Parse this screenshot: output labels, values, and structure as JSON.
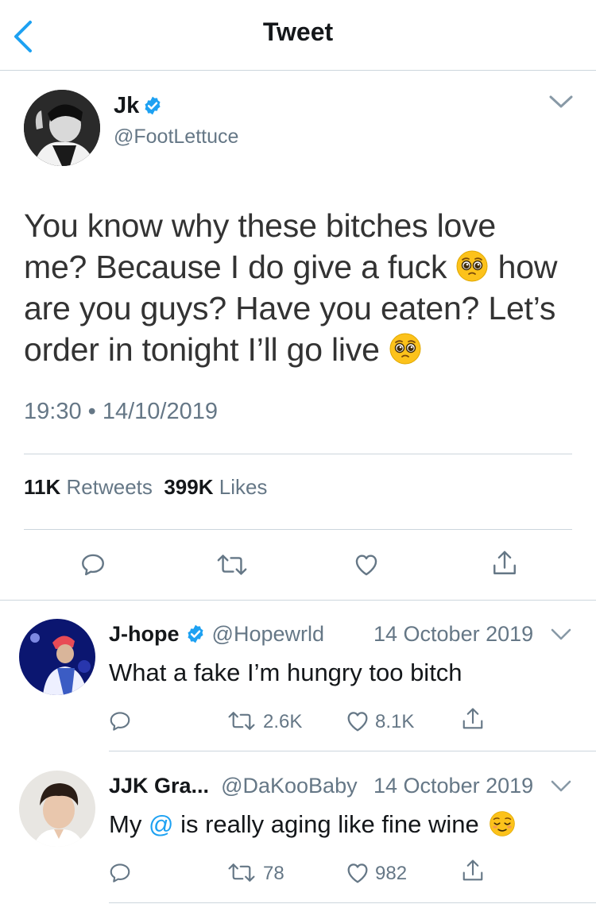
{
  "nav": {
    "title": "Tweet"
  },
  "tweet": {
    "name": "Jk",
    "handle": "@FootLettuce",
    "text_line1": "You know why these bitches love",
    "text_line2_a": "me? Because I do give a fuck",
    "text_line2_b": "how",
    "text_line3": "are you guys? Have you eaten? Let’s",
    "text_line4": "order in tonight I’ll go live",
    "time": "19:30",
    "separator": "•",
    "date": "14/10/2019",
    "retweets_count": "11K",
    "retweets_label": "Retweets",
    "likes_count": "399K",
    "likes_label": "Likes",
    "emoji": "pleading-face"
  },
  "replies": [
    {
      "name": "J-hope",
      "handle": "@Hopewrld",
      "date": "14 October 2019",
      "text": "What a fake I’m hungry too bitch",
      "retweets": "2.6K",
      "likes": "8.1K"
    },
    {
      "name": "JJK Gra...",
      "handle": "@DaKooBaby",
      "date": "14 October 2019",
      "text_a": "My",
      "mention": "@",
      "text_b": "is really aging like fine wine",
      "emoji": "relieved-face",
      "retweets": "78",
      "likes": "982"
    }
  ],
  "colors": {
    "accent": "#1da1f2",
    "secondary_text": "#657786",
    "divider": "#ccd6dd"
  }
}
